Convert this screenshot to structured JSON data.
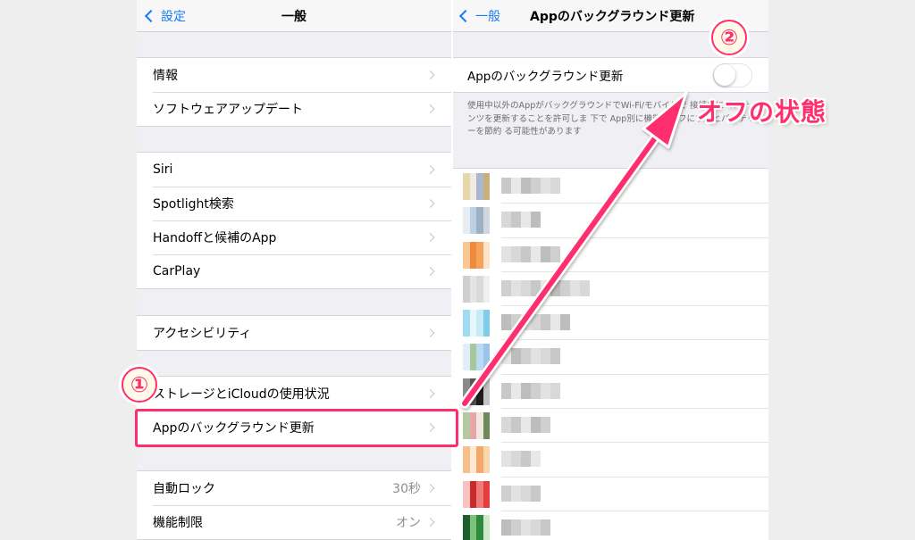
{
  "left": {
    "nav": {
      "back": "設定",
      "title": "一般"
    },
    "groups": [
      [
        "情報",
        "ソフトウェアアップデート"
      ],
      [
        "Siri",
        "Spotlight検索",
        "Handoffと候補のApp",
        "CarPlay"
      ],
      [
        "アクセシビリティ"
      ],
      [
        "ストレージとiCloudの使用状況",
        "Appのバックグラウンド更新"
      ],
      [
        "自動ロック",
        "機能制限"
      ]
    ],
    "values": {
      "auto_lock": "30秒",
      "restrictions": "オン"
    }
  },
  "right": {
    "nav": {
      "back": "一般",
      "title": "Appのバックグラウンド更新"
    },
    "toggle_label": "Appのバックグラウンド更新",
    "toggle_state": "off",
    "footnote": "使用中以外のAppがバックグラウンドでWi-Fi/モバイルで 接続中にコンテンツを更新することを許可しま 下で App別に機能をオフにするとバッテリーを節約 る可能性があります"
  },
  "annotations": {
    "badge_1": "①",
    "badge_2": "②",
    "callout": "オフの状態",
    "accent": "#ff2f6e"
  },
  "colors": {
    "ios_blue": "#1a7bf5"
  }
}
